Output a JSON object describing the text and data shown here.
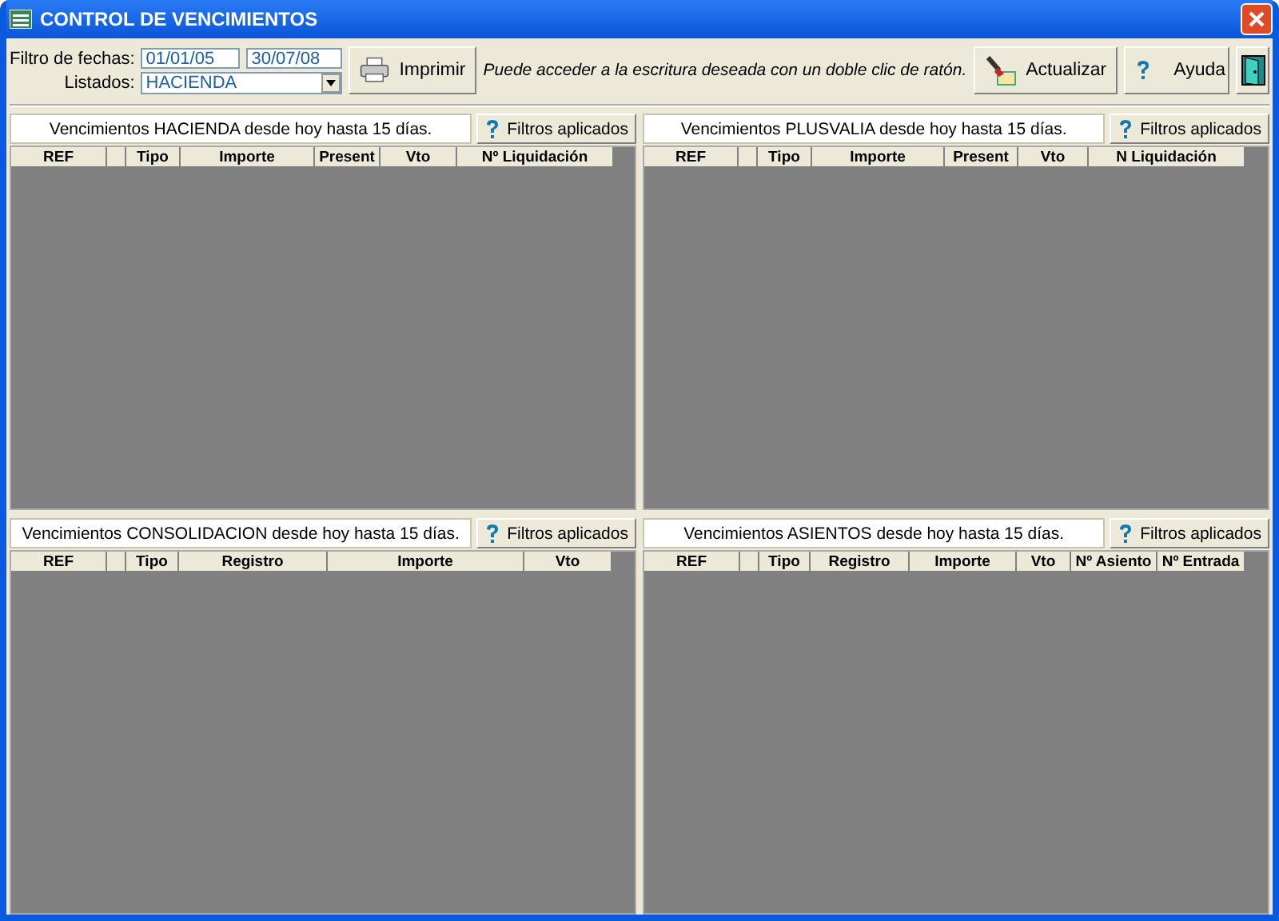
{
  "window": {
    "title": "CONTROL DE VENCIMIENTOS"
  },
  "toolbar": {
    "date_filter_label": "Filtro de fechas:",
    "date_from": "01/01/05",
    "date_to": "30/07/08",
    "list_label": "Listados:",
    "list_value": "HACIENDA",
    "print_button": "Imprimir",
    "hint": "Puede acceder a la escritura deseada con un doble clic de ratón.",
    "refresh_button": "Actualizar",
    "help_button": "Ayuda"
  },
  "panels": [
    {
      "title": "Vencimientos HACIENDA desde hoy hasta 15 días.",
      "filter_button": "Filtros aplicados",
      "columns": [
        "REF",
        "Tipo",
        "Importe",
        "Present",
        "Vto",
        "Nº Liquidación"
      ]
    },
    {
      "title": "Vencimientos PLUSVALIA desde hoy hasta 15 días.",
      "filter_button": "Filtros aplicados",
      "columns": [
        "REF",
        "Tipo",
        "Importe",
        "Present",
        "Vto",
        "N Liquidación"
      ]
    },
    {
      "title": "Vencimientos CONSOLIDACION desde hoy hasta 15 días.",
      "filter_button": "Filtros aplicados",
      "columns": [
        "REF",
        "Tipo",
        "Registro",
        "Importe",
        "Vto"
      ]
    },
    {
      "title": "Vencimientos ASIENTOS desde hoy hasta 15 días.",
      "filter_button": "Filtros aplicados",
      "columns": [
        "REF",
        "Tipo",
        "Registro",
        "Importe",
        "Vto",
        "Nº Asiento",
        "Nº Entrada"
      ]
    }
  ]
}
